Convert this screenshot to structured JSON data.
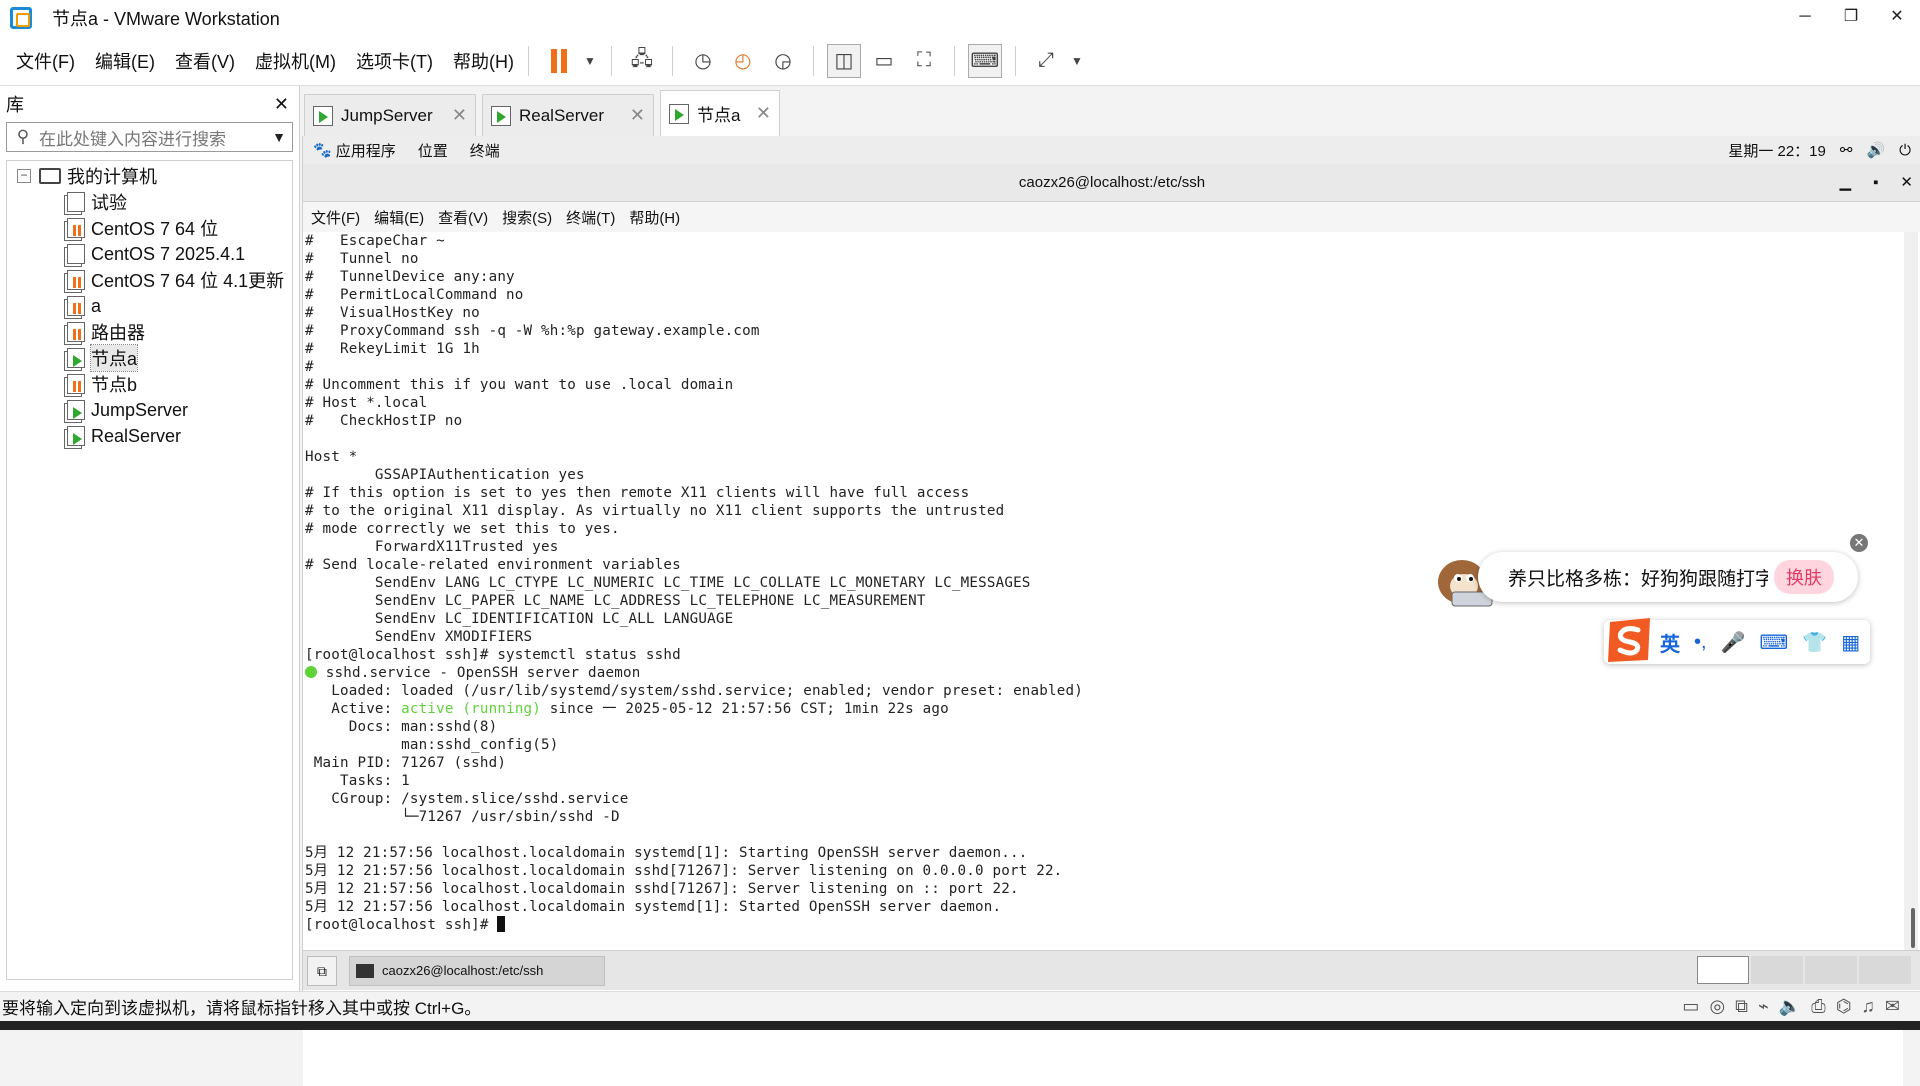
{
  "window": {
    "title": "节点a - VMware Workstation",
    "minimize": "─",
    "maximize": "❐",
    "close": "✕"
  },
  "menu": [
    "文件(F)",
    "编辑(E)",
    "查看(V)",
    "虚拟机(M)",
    "选项卡(T)",
    "帮助(H)"
  ],
  "toolbar": {
    "accent": "#f0701a"
  },
  "library": {
    "title": "库",
    "close": "✕",
    "search_placeholder": "在此处键入内容进行搜索",
    "root": "我的计算机",
    "items": [
      {
        "label": "试验",
        "state": "off"
      },
      {
        "label": "CentOS 7 64 位",
        "state": "pause"
      },
      {
        "label": "CentOS 7 2025.4.1",
        "state": "off"
      },
      {
        "label": "CentOS 7 64 位 4.1更新",
        "state": "pause"
      },
      {
        "label": "a",
        "state": "pause"
      },
      {
        "label": "路由器",
        "state": "pause"
      },
      {
        "label": "节点a",
        "state": "run"
      },
      {
        "label": "节点b",
        "state": "pause"
      },
      {
        "label": "JumpServer",
        "state": "run"
      },
      {
        "label": "RealServer",
        "state": "run"
      }
    ]
  },
  "tabs": [
    {
      "label": "JumpServer",
      "close": "✕"
    },
    {
      "label": "RealServer",
      "close": "✕"
    },
    {
      "label": "节点a",
      "close": "✕"
    }
  ],
  "gnome": {
    "apps": "应用程序",
    "places": "位置",
    "terminal": "终端",
    "clock": "星期一 22：19"
  },
  "terminal": {
    "title": "caozx26@localhost:/etc/ssh",
    "min": "▁",
    "max": "▪",
    "close": "✕",
    "menu": [
      "文件(F)",
      "编辑(E)",
      "查看(V)",
      "搜索(S)",
      "终端(T)",
      "帮助(H)"
    ],
    "lines_top": "#   EscapeChar ~\n#   Tunnel no\n#   TunnelDevice any:any\n#   PermitLocalCommand no\n#   VisualHostKey no\n#   ProxyCommand ssh -q -W %h:%p gateway.example.com\n#   RekeyLimit 1G 1h\n#\n# Uncomment this if you want to use .local domain\n# Host *.local\n#   CheckHostIP no\n\nHost *\n        GSSAPIAuthentication yes\n# If this option is set to yes then remote X11 clients will have full access\n# to the original X11 display. As virtually no X11 client supports the untrusted\n# mode correctly we set this to yes.\n        ForwardX11Trusted yes\n# Send locale-related environment variables\n        SendEnv LANG LC_CTYPE LC_NUMERIC LC_TIME LC_COLLATE LC_MONETARY LC_MESSAGES\n        SendEnv LC_PAPER LC_NAME LC_ADDRESS LC_TELEPHONE LC_MEASUREMENT\n        SendEnv LC_IDENTIFICATION LC_ALL LANGUAGE\n        SendEnv XMODIFIERS\n[root@localhost ssh]# systemctl status sshd",
    "service_line": " sshd.service - OpenSSH server daemon",
    "loaded": "   Loaded: loaded (/usr/lib/systemd/system/sshd.service; enabled; vendor preset: enabled)",
    "active_pre": "   Active: ",
    "active_status": "active (running)",
    "active_post": " since 一 2025-05-12 21:57:56 CST; 1min 22s ago",
    "lines_bottom": "     Docs: man:sshd(8)\n           man:sshd_config(5)\n Main PID: 71267 (sshd)\n    Tasks: 1\n   CGroup: /system.slice/sshd.service\n           └─71267 /usr/sbin/sshd -D\n\n5月 12 21:57:56 localhost.localdomain systemd[1]: Starting OpenSSH server daemon...\n5月 12 21:57:56 localhost.localdomain sshd[71267]: Server listening on 0.0.0.0 port 22.\n5月 12 21:57:56 localhost.localdomain sshd[71267]: Server listening on :: port 22.\n5月 12 21:57:56 localhost.localdomain systemd[1]: Started OpenSSH server daemon.",
    "prompt": "[root@localhost ssh]# "
  },
  "guest_taskbar": {
    "task": "caozx26@localhost:/etc/ssh"
  },
  "ime": {
    "tip": "养只比格多栋：好狗狗跟随打字",
    "swap": "换肤",
    "close": "✕",
    "lang": "英",
    "punct": "•,",
    "mic": "🎤",
    "keyboard": "⌨",
    "shirt": "👕",
    "grid": "▦"
  },
  "status": {
    "hint": "要将输入定向到该虚拟机，请将鼠标指针移入其中或按 Ctrl+G。"
  }
}
